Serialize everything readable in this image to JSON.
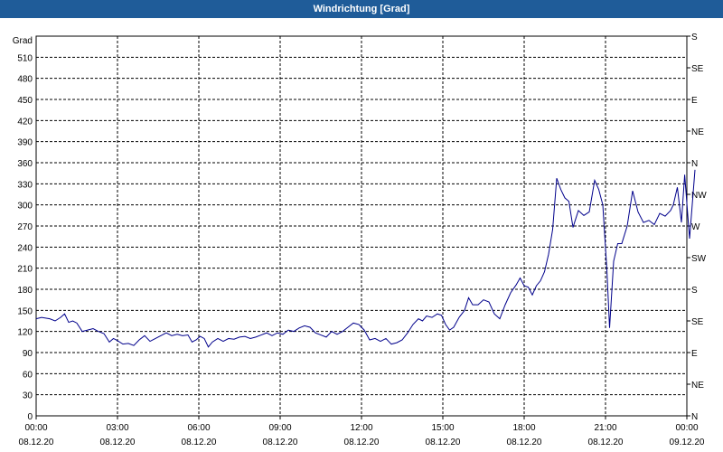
{
  "window": {
    "title": "Windrichtung [Grad]"
  },
  "colors": {
    "titlebar": "#1f5c99",
    "series": "#00008b",
    "grid": "#000000"
  },
  "chart_data": {
    "type": "line",
    "title": "Windrichtung [Grad]",
    "ylabel": "Grad",
    "ylim": [
      0,
      540
    ],
    "grid": true,
    "y_ticks": [
      0,
      30,
      60,
      90,
      120,
      150,
      180,
      210,
      240,
      270,
      300,
      330,
      360,
      390,
      420,
      450,
      480,
      510
    ],
    "y2_ticks": [
      "N",
      "NE",
      "E",
      "SE",
      "S",
      "SW",
      "W",
      "NW",
      "N",
      "NE",
      "E",
      "SE",
      "S"
    ],
    "x_ticks": [
      {
        "time": "00:00",
        "date": "08.12.20"
      },
      {
        "time": "03:00",
        "date": "08.12.20"
      },
      {
        "time": "06:00",
        "date": "08.12.20"
      },
      {
        "time": "09:00",
        "date": "08.12.20"
      },
      {
        "time": "12:00",
        "date": "08.12.20"
      },
      {
        "time": "15:00",
        "date": "08.12.20"
      },
      {
        "time": "18:00",
        "date": "08.12.20"
      },
      {
        "time": "21:00",
        "date": "08.12.20"
      },
      {
        "time": "00:00",
        "date": "09.12.20"
      }
    ],
    "xlim_hours": [
      0,
      24
    ],
    "series": [
      {
        "points": [
          [
            0,
            138
          ],
          [
            0.2,
            140
          ],
          [
            0.5,
            138
          ],
          [
            0.7,
            135
          ],
          [
            0.9,
            140
          ],
          [
            1.05,
            145
          ],
          [
            1.2,
            133
          ],
          [
            1.35,
            135
          ],
          [
            1.5,
            132
          ],
          [
            1.7,
            120
          ],
          [
            1.9,
            122
          ],
          [
            2.1,
            124
          ],
          [
            2.3,
            120
          ],
          [
            2.5,
            117
          ],
          [
            2.7,
            105
          ],
          [
            2.85,
            110
          ],
          [
            3.0,
            107
          ],
          [
            3.2,
            102
          ],
          [
            3.4,
            103
          ],
          [
            3.6,
            100
          ],
          [
            3.8,
            108
          ],
          [
            4.0,
            114
          ],
          [
            4.2,
            106
          ],
          [
            4.4,
            110
          ],
          [
            4.6,
            114
          ],
          [
            4.8,
            118
          ],
          [
            5.0,
            114
          ],
          [
            5.2,
            116
          ],
          [
            5.4,
            114
          ],
          [
            5.6,
            115
          ],
          [
            5.75,
            105
          ],
          [
            5.9,
            108
          ],
          [
            6.05,
            113
          ],
          [
            6.2,
            110
          ],
          [
            6.35,
            98
          ],
          [
            6.5,
            105
          ],
          [
            6.7,
            110
          ],
          [
            6.9,
            106
          ],
          [
            7.1,
            110
          ],
          [
            7.3,
            109
          ],
          [
            7.5,
            112
          ],
          [
            7.7,
            113
          ],
          [
            7.9,
            110
          ],
          [
            8.1,
            112
          ],
          [
            8.3,
            115
          ],
          [
            8.5,
            118
          ],
          [
            8.7,
            114
          ],
          [
            8.9,
            118
          ],
          [
            9.1,
            116
          ],
          [
            9.3,
            122
          ],
          [
            9.5,
            120
          ],
          [
            9.7,
            125
          ],
          [
            9.9,
            128
          ],
          [
            10.1,
            126
          ],
          [
            10.3,
            118
          ],
          [
            10.5,
            115
          ],
          [
            10.7,
            112
          ],
          [
            10.9,
            120
          ],
          [
            11.1,
            116
          ],
          [
            11.3,
            120
          ],
          [
            11.5,
            126
          ],
          [
            11.7,
            132
          ],
          [
            11.9,
            130
          ],
          [
            12.1,
            122
          ],
          [
            12.3,
            108
          ],
          [
            12.5,
            110
          ],
          [
            12.7,
            106
          ],
          [
            12.9,
            110
          ],
          [
            13.1,
            102
          ],
          [
            13.3,
            104
          ],
          [
            13.5,
            108
          ],
          [
            13.7,
            118
          ],
          [
            13.9,
            130
          ],
          [
            14.1,
            138
          ],
          [
            14.25,
            135
          ],
          [
            14.4,
            142
          ],
          [
            14.6,
            140
          ],
          [
            14.8,
            145
          ],
          [
            14.95,
            143
          ],
          [
            15.1,
            130
          ],
          [
            15.25,
            122
          ],
          [
            15.4,
            126
          ],
          [
            15.6,
            140
          ],
          [
            15.8,
            150
          ],
          [
            15.95,
            168
          ],
          [
            16.1,
            158
          ],
          [
            16.3,
            158
          ],
          [
            16.5,
            165
          ],
          [
            16.7,
            162
          ],
          [
            16.9,
            145
          ],
          [
            17.1,
            138
          ],
          [
            17.3,
            158
          ],
          [
            17.5,
            175
          ],
          [
            17.7,
            186
          ],
          [
            17.85,
            196
          ],
          [
            18.0,
            185
          ],
          [
            18.15,
            183
          ],
          [
            18.3,
            172
          ],
          [
            18.45,
            185
          ],
          [
            18.6,
            192
          ],
          [
            18.75,
            205
          ],
          [
            18.9,
            230
          ],
          [
            19.05,
            265
          ],
          [
            19.2,
            338
          ],
          [
            19.35,
            322
          ],
          [
            19.5,
            310
          ],
          [
            19.65,
            305
          ],
          [
            19.8,
            268
          ],
          [
            20.0,
            292
          ],
          [
            20.2,
            285
          ],
          [
            20.4,
            290
          ],
          [
            20.6,
            335
          ],
          [
            20.75,
            322
          ],
          [
            20.9,
            300
          ],
          [
            21.05,
            208
          ],
          [
            21.15,
            125
          ],
          [
            21.3,
            220
          ],
          [
            21.45,
            245
          ],
          [
            21.6,
            245
          ],
          [
            21.8,
            270
          ],
          [
            22.0,
            320
          ],
          [
            22.2,
            290
          ],
          [
            22.4,
            275
          ],
          [
            22.6,
            278
          ],
          [
            22.8,
            272
          ],
          [
            23.0,
            288
          ],
          [
            23.2,
            284
          ],
          [
            23.4,
            292
          ],
          [
            23.5,
            300
          ],
          [
            23.65,
            325
          ],
          [
            23.8,
            275
          ],
          [
            23.92,
            343
          ],
          [
            24.1,
            252
          ],
          [
            24.3,
            350
          ]
        ]
      }
    ]
  }
}
